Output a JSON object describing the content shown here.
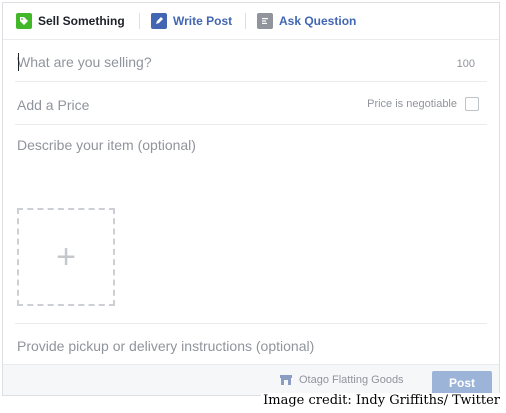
{
  "tabs": [
    {
      "label": "Sell Something",
      "icon": "tag-icon",
      "active": true
    },
    {
      "label": "Write Post",
      "icon": "pencil-icon",
      "active": false
    },
    {
      "label": "Ask Question",
      "icon": "list-icon",
      "active": false
    }
  ],
  "form": {
    "title_placeholder": "What are you selling?",
    "title_value": "",
    "char_counter": "100",
    "price_placeholder": "Add a Price",
    "price_value": "",
    "negotiable_label": "Price is negotiable",
    "negotiable_checked": false,
    "description_placeholder": "Describe your item (optional)",
    "photo_add_glyph": "+",
    "pickup_placeholder": "Provide pickup or delivery instructions (optional)"
  },
  "footer": {
    "page_name": "Otago Flatting Goods",
    "page_icon": "page-store-icon",
    "post_label": "Post"
  },
  "credit": "Image credit: Indy Griffiths/ Twitter",
  "colors": {
    "accent_blue": "#4267b2",
    "sell_green": "#42b72a",
    "post_disabled": "#9cb4d8",
    "muted_text": "#90949c"
  }
}
